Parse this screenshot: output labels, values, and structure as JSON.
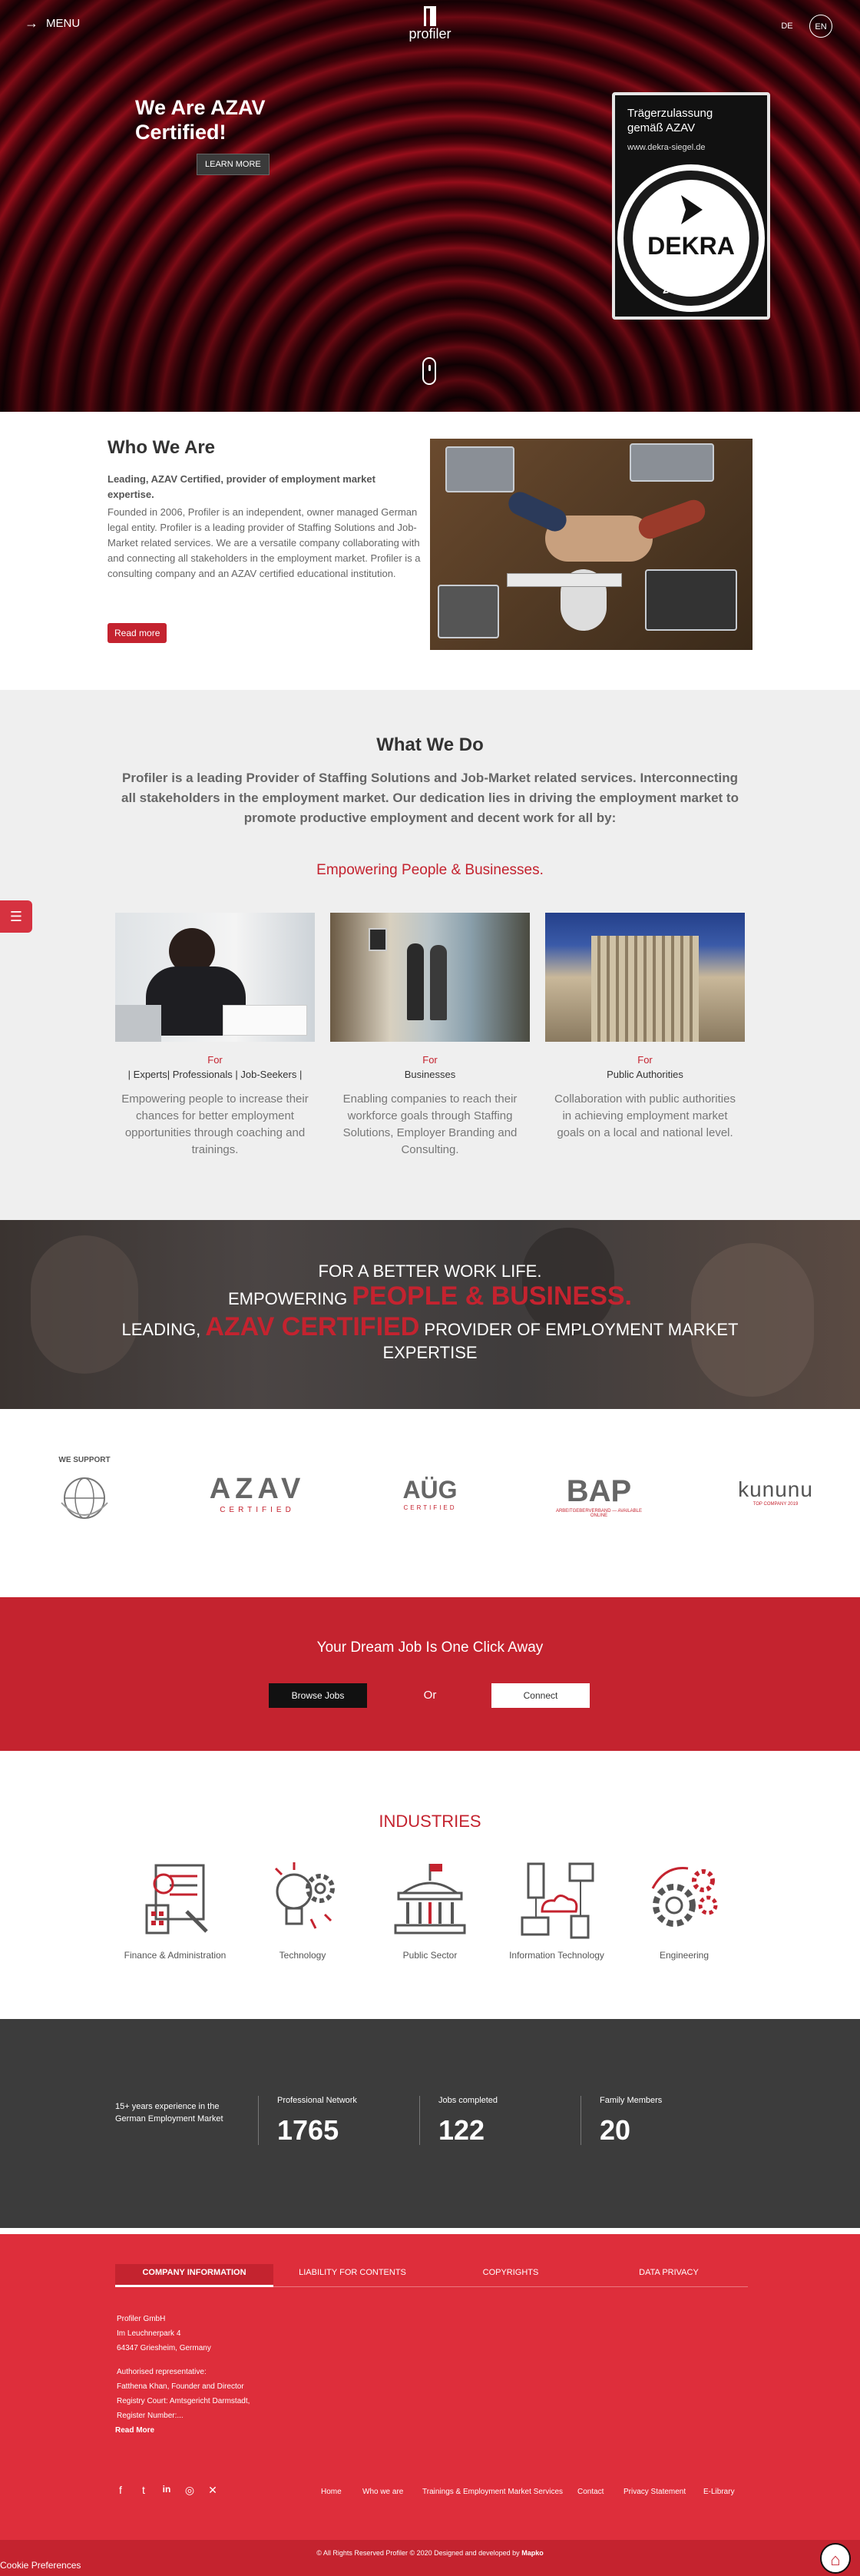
{
  "header": {
    "menu_label": "MENU",
    "logo_text": "profiler",
    "lang_de": "DE",
    "lang_en": "EN"
  },
  "hero": {
    "title": "We Are AZAV Certified!",
    "button": "LEARN MORE",
    "badge_line1": "Trägerzulassung",
    "badge_line2": "gemäß AZAV",
    "badge_url": "www.dekra-siegel.de",
    "badge_brand": "DEKRA",
    "badge_sub": "zertifiziert"
  },
  "who": {
    "title": "Who We Are",
    "lead": "Leading, AZAV Certified, provider of employment market expertise.",
    "body": "Founded in 2006, Profiler is an independent, owner managed German legal entity. Profiler is a leading provider of Staffing Solutions and Job-Market related services. We are a versatile company collaborating with and connecting all stakeholders in the employment market. Profiler is a consulting company and an AZAV certified educational institution.",
    "button": "Read more"
  },
  "what": {
    "title": "What We Do",
    "lead": "Profiler is a leading Provider of Staffing Solutions and Job-Market related services. Interconnecting all stakeholders in the employment market. Our dedication lies in driving the employment market to promote productive employment and decent work for all by:",
    "tagline": "Empowering People & Businesses.",
    "side_tab": "☰",
    "columns": [
      {
        "for": "For",
        "who": "| Experts| Professionals | Job-Seekers |",
        "desc": "Empowering people to increase their chances for better employment opportunities through coaching and trainings."
      },
      {
        "for": "For",
        "who": "Businesses",
        "desc": "Enabling companies to reach their workforce goals through Staffing Solutions, Employer Branding and Consulting."
      },
      {
        "for": "For",
        "who": "Public Authorities",
        "desc": "Collaboration with public authorities in achieving employment market goals on a local and national level."
      }
    ]
  },
  "banner": {
    "line1": "FOR A BETTER WORK LIFE.",
    "line2a": "EMPOWERING",
    "line2b": "PEOPLE & BUSINESS.",
    "line3a": "LEADING,",
    "line3b": "AZAV CERTIFIED",
    "line3c": "PROVIDER OF EMPLOYMENT MARKET EXPERTISE"
  },
  "logos": {
    "we_support": "WE SUPPORT",
    "global_compact": "UNITED NATIONS GLOBAL COMPACT",
    "azav": "AZAV",
    "azav_sub": "CERTIFIED",
    "aug": "AÜG",
    "aug_sub": "CERTIFIED",
    "bap": "BAP",
    "bap_sub": "ARBEITGEBERVERBAND — AVAILABLE ONLINE",
    "kununu": "kununu",
    "kununu_sub": "TOP COMPANY 2019"
  },
  "cta": {
    "title": "Your Dream Job Is One Click Away",
    "browse": "Browse Jobs",
    "or": "Or",
    "connect": "Connect"
  },
  "industries": {
    "title": "INDUSTRIES",
    "items": [
      "Finance & Administration",
      "Technology",
      "Public Sector",
      "Information Technology",
      "Engineering"
    ]
  },
  "stats": {
    "lead": "15+ years experience in the German Employment Market",
    "items": [
      {
        "label": "Professional Network",
        "value": "1765"
      },
      {
        "label": "Jobs completed",
        "value": "122"
      },
      {
        "label": "Family Members",
        "value": "20"
      }
    ]
  },
  "footer": {
    "tabs": [
      "COMPANY INFORMATION",
      "LIABILITY FOR CONTENTS",
      "COPYRIGHTS",
      "DATA PRIVACY"
    ],
    "address": [
      "Profiler GmbH",
      "Im Leuchnerpark 4",
      "64347 Griesheim, Germany"
    ],
    "rep": [
      "Authorised representative:",
      "Fatthena Khan, Founder and Director",
      "Registry Court: Amtsgericht Darmstadt,",
      "Register Number:..."
    ],
    "read_more": "Read More",
    "social": [
      "f",
      "t",
      "in",
      "◎",
      "✕"
    ],
    "links": [
      "Home",
      "Who we are",
      "Trainings & Employment Market Services",
      "Contact",
      "Privacy Statement",
      "E-Library"
    ],
    "copyright_a": "© All Rights Reserved Profiler © 2020 Designed and developed by",
    "copyright_b": "Mapko",
    "cookie": "Cookie Preferences"
  },
  "colors": {
    "brand_red": "#c4232f",
    "footer_red": "#de2e3b",
    "dark": "#3c3c3c"
  }
}
